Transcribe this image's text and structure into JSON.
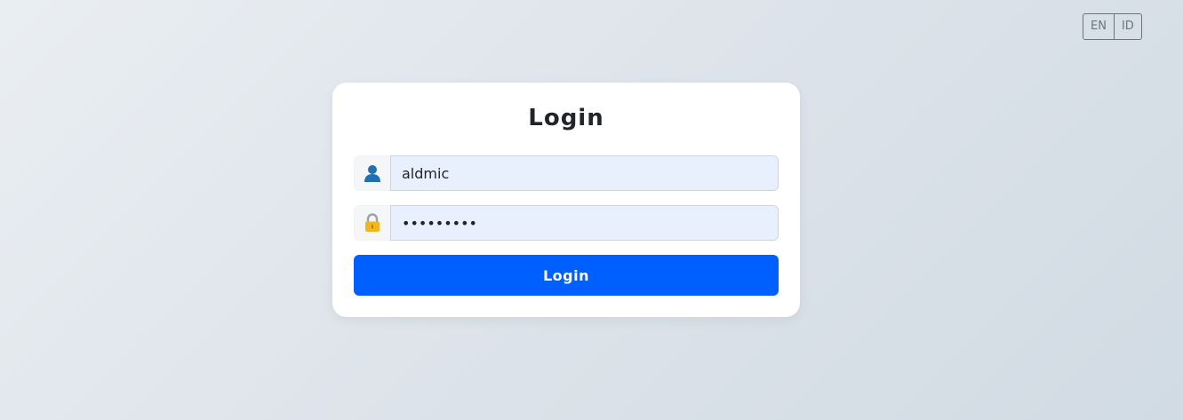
{
  "language_switcher": {
    "options": [
      {
        "label": "EN"
      },
      {
        "label": "ID"
      }
    ]
  },
  "login_form": {
    "title": "Login",
    "username": {
      "icon": "user-icon",
      "value": "aldmic"
    },
    "password": {
      "icon": "lock-icon",
      "value": "password1"
    },
    "submit_label": "Login"
  },
  "colors": {
    "primary": "#0060ff",
    "input_fill": "#e8f0fe",
    "card": "#ffffff"
  }
}
